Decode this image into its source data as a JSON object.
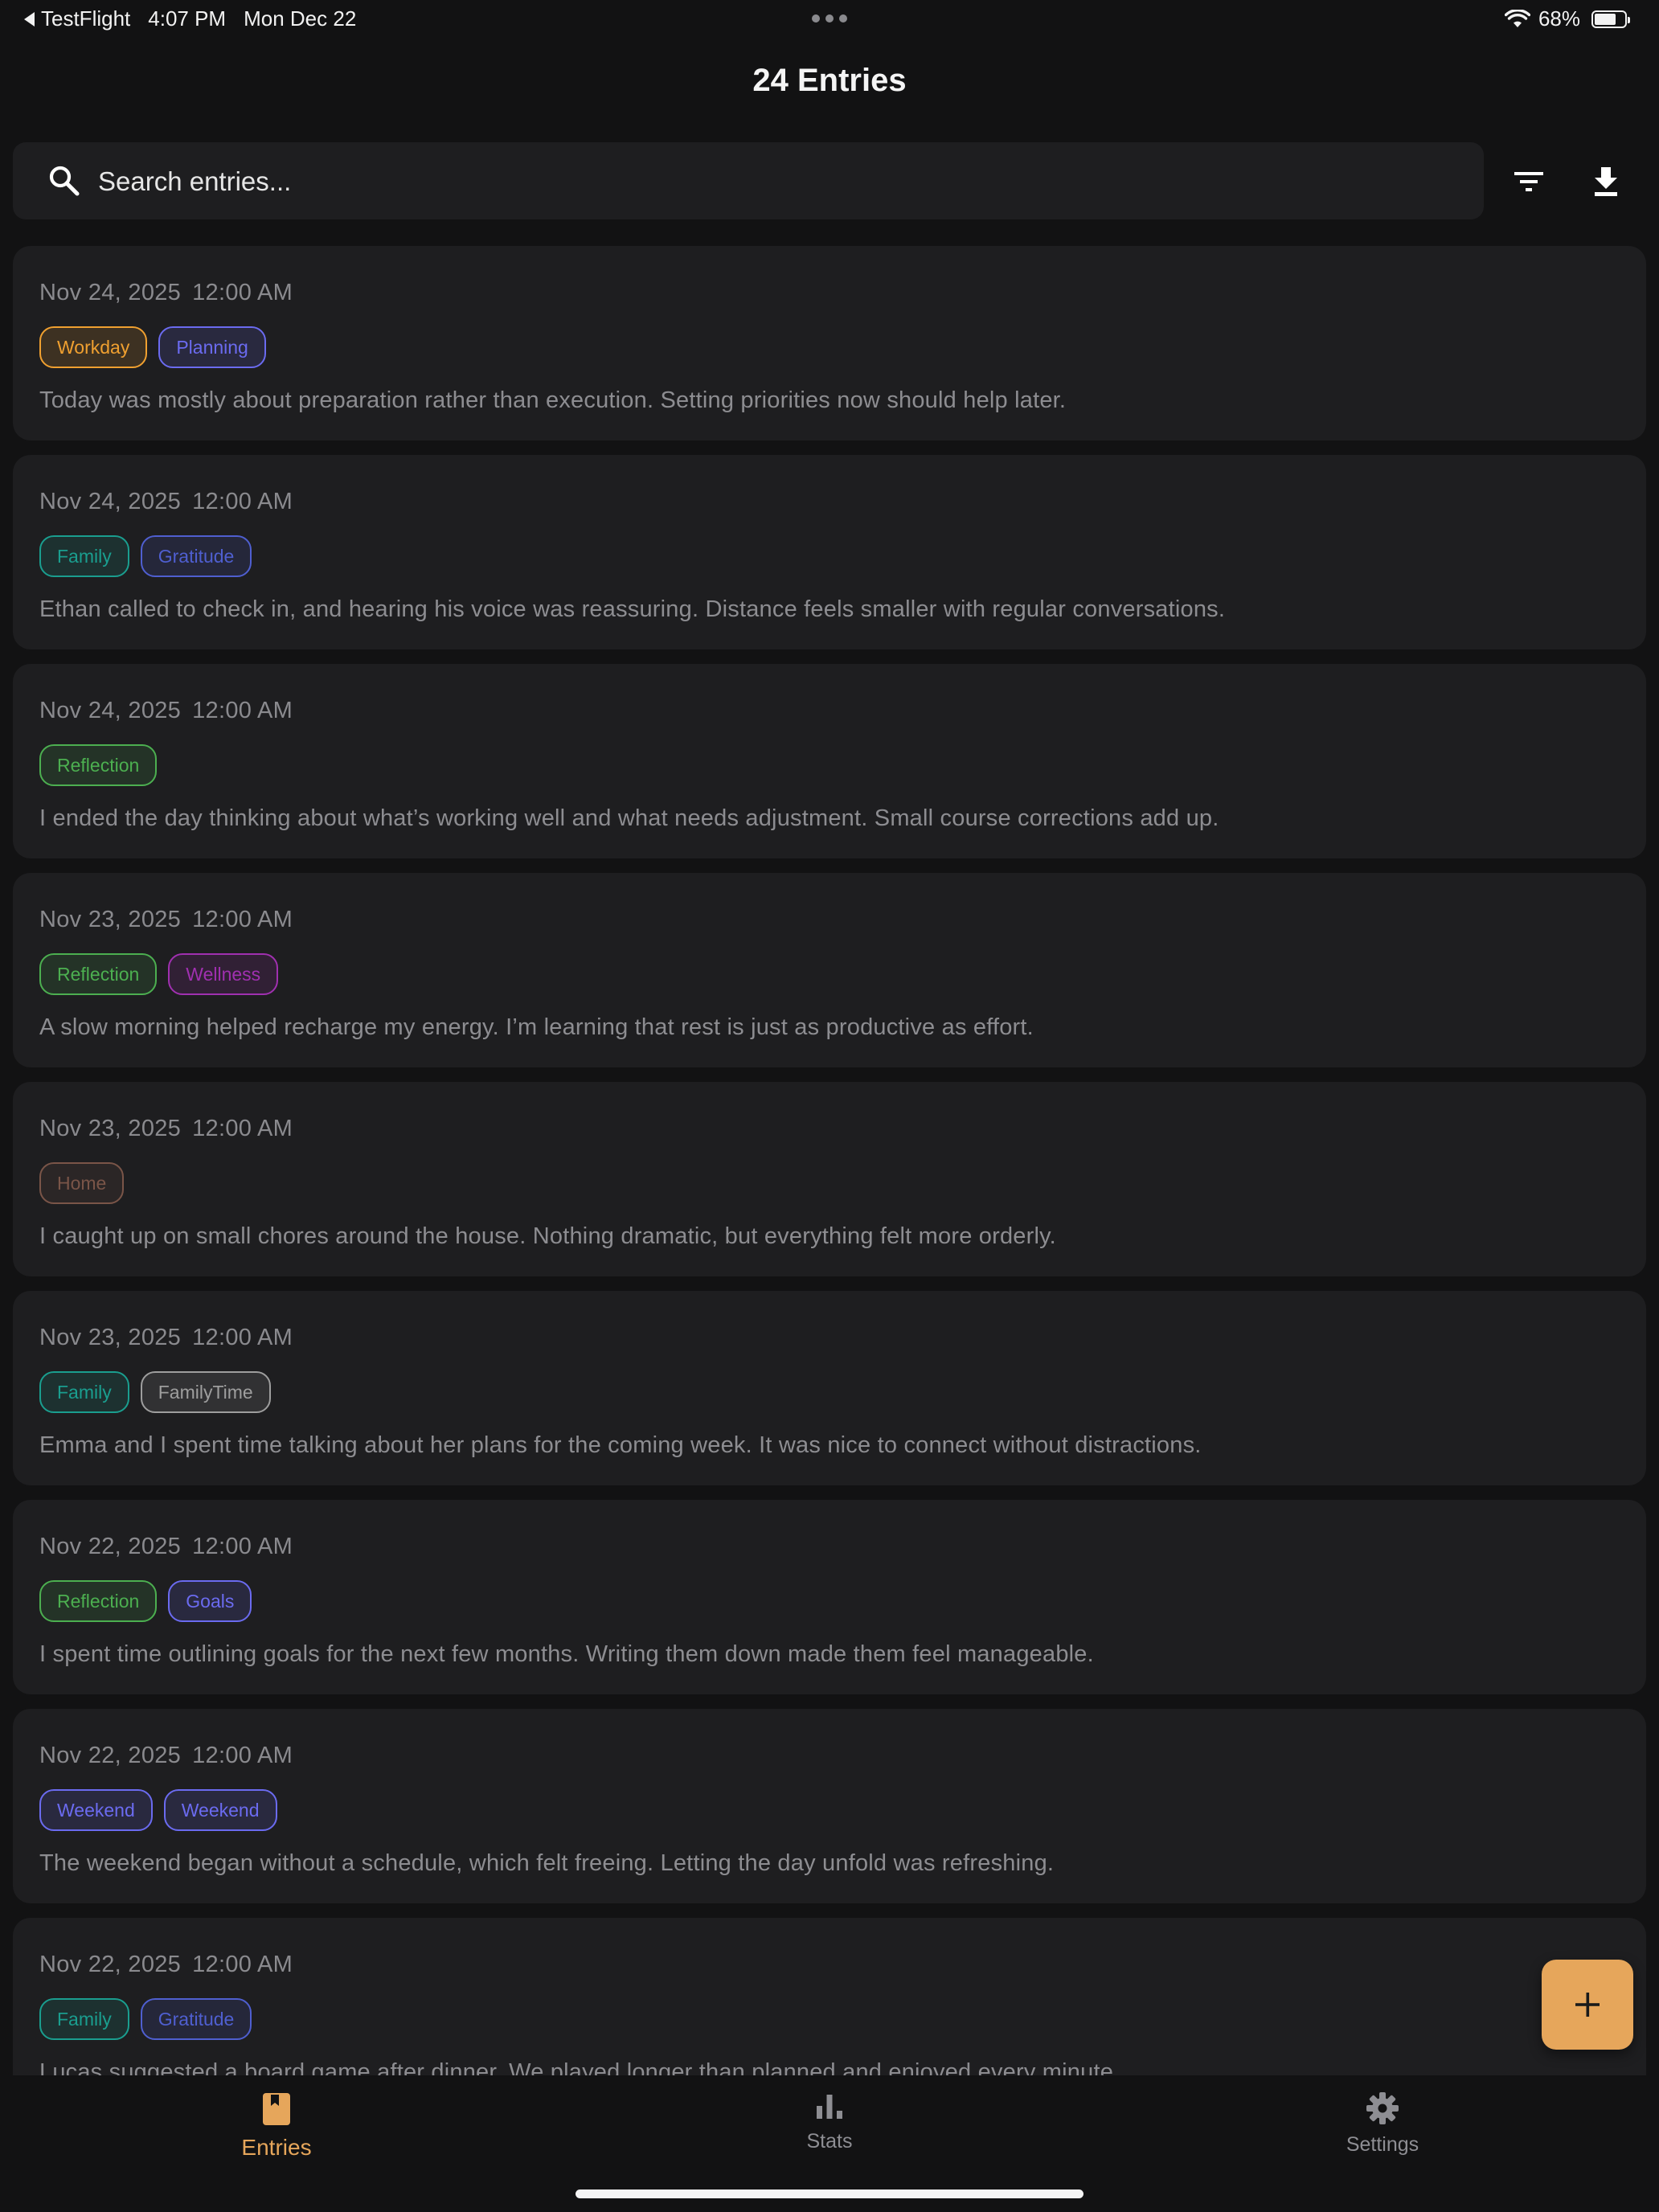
{
  "status_bar": {
    "back_app": "TestFlight",
    "time": "4:07 PM",
    "date": "Mon Dec 22",
    "battery": "68%"
  },
  "header": {
    "title": "24 Entries"
  },
  "search": {
    "placeholder": "Search entries..."
  },
  "toolbar": {
    "filter_icon": "filter-icon",
    "download_icon": "download-icon"
  },
  "entries": [
    {
      "date": "Nov 24, 2025",
      "time": "12:00 AM",
      "tags": [
        {
          "label": "Workday",
          "color": "#f0a030"
        },
        {
          "label": "Planning",
          "color": "#6b6bf0"
        }
      ],
      "text": "Today was mostly about preparation rather than execution. Setting priorities now should help later."
    },
    {
      "date": "Nov 24, 2025",
      "time": "12:00 AM",
      "tags": [
        {
          "label": "Family",
          "color": "#1a9e8f"
        },
        {
          "label": "Gratitude",
          "color": "#4f5fd0"
        }
      ],
      "text": "Ethan called to check in, and hearing his voice was reassuring. Distance feels smaller with regular conversations."
    },
    {
      "date": "Nov 24, 2025",
      "time": "12:00 AM",
      "tags": [
        {
          "label": "Reflection",
          "color": "#4caf50"
        }
      ],
      "text": "I ended the day thinking about what’s working well and what needs adjustment. Small course corrections add up."
    },
    {
      "date": "Nov 23, 2025",
      "time": "12:00 AM",
      "tags": [
        {
          "label": "Reflection",
          "color": "#4caf50"
        },
        {
          "label": "Wellness",
          "color": "#a030b0"
        }
      ],
      "text": "A slow morning helped recharge my energy. I’m learning that rest is just as productive as effort."
    },
    {
      "date": "Nov 23, 2025",
      "time": "12:00 AM",
      "tags": [
        {
          "label": "Home",
          "color": "#7a5548"
        }
      ],
      "text": "I caught up on small chores around the house. Nothing dramatic, but everything felt more orderly."
    },
    {
      "date": "Nov 23, 2025",
      "time": "12:00 AM",
      "tags": [
        {
          "label": "Family",
          "color": "#1a9e8f"
        },
        {
          "label": "FamilyTime",
          "color": "#9e9e9e"
        }
      ],
      "text": "Emma and I spent time talking about her plans for the coming week. It was nice to connect without distractions."
    },
    {
      "date": "Nov 22, 2025",
      "time": "12:00 AM",
      "tags": [
        {
          "label": "Reflection",
          "color": "#4caf50"
        },
        {
          "label": "Goals",
          "color": "#6b6bf0"
        }
      ],
      "text": "I spent time outlining goals for the next few months. Writing them down made them feel manageable."
    },
    {
      "date": "Nov 22, 2025",
      "time": "12:00 AM",
      "tags": [
        {
          "label": "Weekend",
          "color": "#6b6bf0"
        },
        {
          "label": "Weekend",
          "color": "#6b6bf0"
        }
      ],
      "text": "The weekend began without a schedule, which felt freeing. Letting the day unfold was refreshing."
    },
    {
      "date": "Nov 22, 2025",
      "time": "12:00 AM",
      "tags": [
        {
          "label": "Family",
          "color": "#1a9e8f"
        },
        {
          "label": "Gratitude",
          "color": "#4f5fd0"
        }
      ],
      "text": "Lucas suggested a board game after dinner. We played longer than planned and enjoyed every minute."
    }
  ],
  "fab": {
    "icon": "plus-icon"
  },
  "tabs": [
    {
      "label": "Entries",
      "icon": "book-icon",
      "active": true
    },
    {
      "label": "Stats",
      "icon": "bar-chart-icon",
      "active": false
    },
    {
      "label": "Settings",
      "icon": "gear-icon",
      "active": false
    }
  ],
  "colors": {
    "accent": "#e6a65b",
    "background": "#121213",
    "card": "#1e1e20"
  }
}
